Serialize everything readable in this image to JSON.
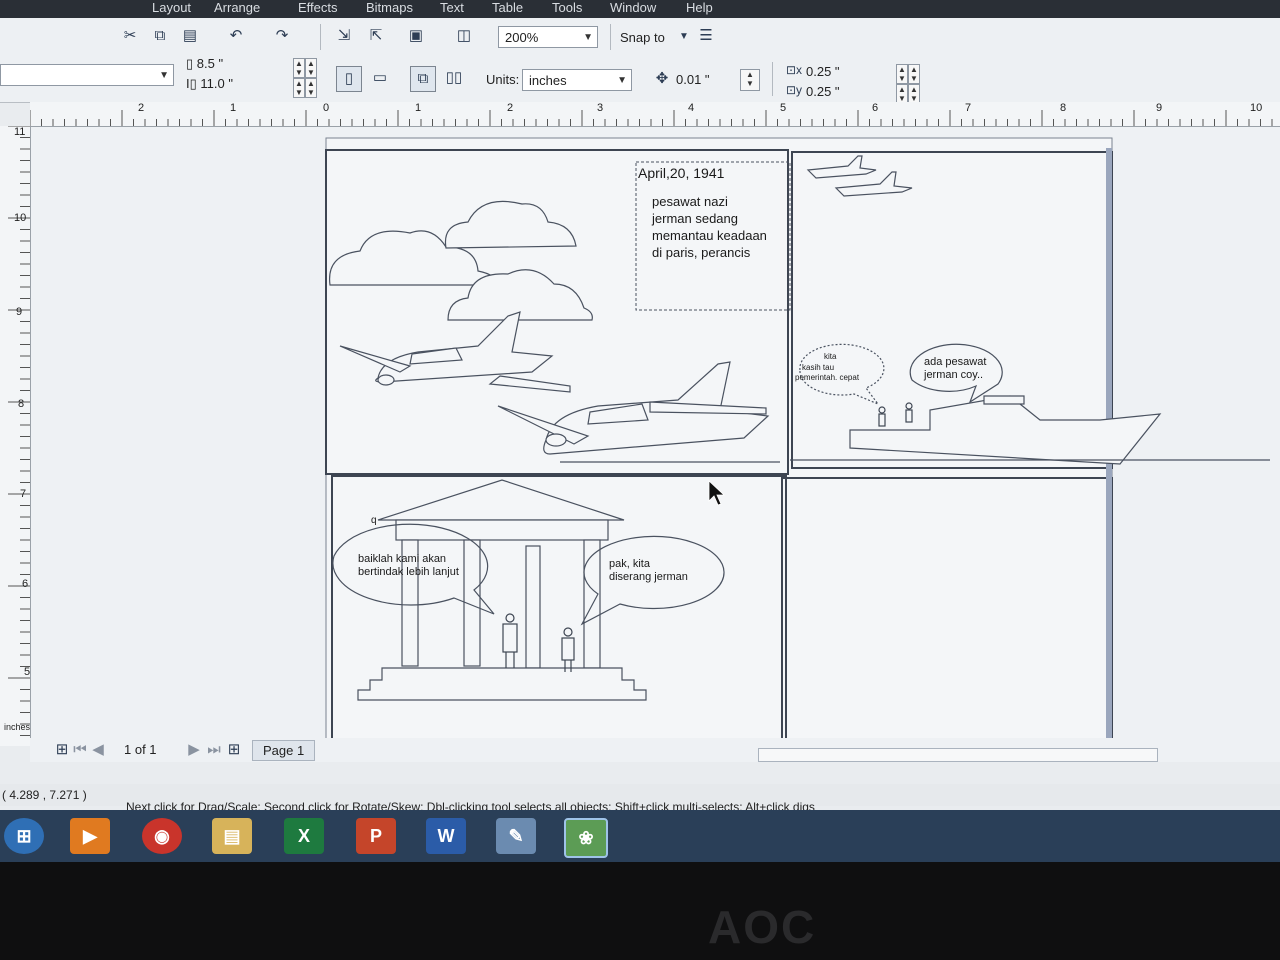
{
  "menubar": {
    "items": [
      "Layout",
      "Arrange",
      "Effects",
      "Bitmaps",
      "Text",
      "Table",
      "Tools",
      "Window",
      "Help"
    ]
  },
  "toolbar": {
    "zoom": "200%",
    "snap_to_label": "Snap to",
    "page_width": "8.5 \"",
    "page_height": "11.0 \"",
    "units_label": "Units:",
    "units_value": "inches",
    "nudge": "0.01 \"",
    "dup_x": "0.25 \"",
    "dup_y": "0.25 \""
  },
  "ruler": {
    "h_ticks": [
      "2",
      "1",
      "0",
      "1",
      "2",
      "3",
      "4",
      "5",
      "6",
      "7",
      "8",
      "9",
      "10"
    ],
    "v_ticks": [
      "11",
      "10",
      "9",
      "8",
      "7",
      "6",
      "5"
    ],
    "unit": "inches"
  },
  "drawing": {
    "caption_date": "April,20, 1941",
    "caption_text": [
      "pesawat nazi",
      "jerman sedang",
      "memantau keadaan",
      "di paris, perancis"
    ],
    "bubble_ship_left": [
      "kita",
      "kasih tau",
      "pemerintah. cepat"
    ],
    "bubble_ship_right": [
      "ada pesawat",
      "jerman coy.."
    ],
    "bubble_building_left_q": "q",
    "bubble_building_left": [
      "baiklah kami akan",
      "bertindak lebih lanjut"
    ],
    "bubble_building_right": [
      "pak, kita",
      "diserang jerman"
    ]
  },
  "pagenav": {
    "count": "1 of 1",
    "tab": "Page 1"
  },
  "status": {
    "coords": "( 4.289 , 7.271 )",
    "hint": "Next click for Drag/Scale; Second click for Rotate/Skew; Dbl-clicking tool selects all objects; Shift+click multi-selects; Alt+click digs"
  },
  "taskbar": {
    "apps": [
      "start",
      "media-player",
      "chrome",
      "file-explorer",
      "excel",
      "powerpoint",
      "word",
      "paint",
      "coreldraw"
    ]
  },
  "monitor": {
    "brand": "AOC"
  }
}
